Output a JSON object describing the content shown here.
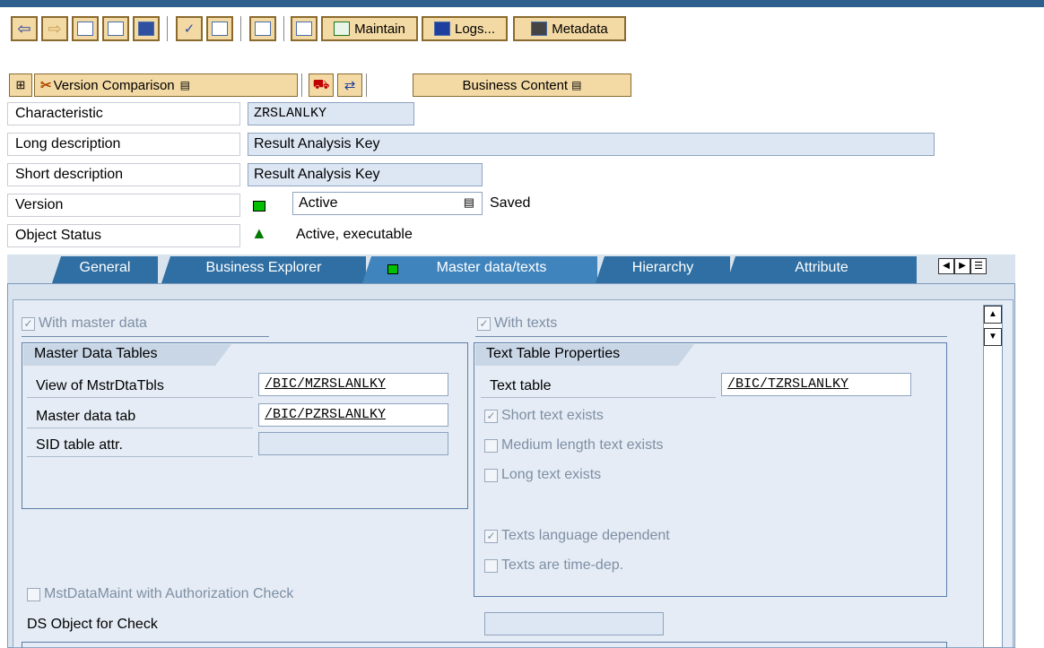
{
  "toolbar": {
    "maintain_label": "Maintain",
    "logs_label": "Logs...",
    "metadata_label": "Metadata"
  },
  "app_toolbar": {
    "version_comparison_label": "Version Comparison",
    "business_content_label": "Business Content"
  },
  "header": {
    "characteristic_label": "Characteristic",
    "characteristic_value": "ZRSLANLKY",
    "long_desc_label": "Long description",
    "long_desc_value": "Result Analysis Key",
    "short_desc_label": "Short description",
    "short_desc_value": "Result Analysis Key",
    "version_label": "Version",
    "version_value": "Active",
    "version_status": "Saved",
    "object_status_label": "Object Status",
    "object_status_value": "Active, executable"
  },
  "tabs": [
    {
      "label": "General"
    },
    {
      "label": "Business Explorer"
    },
    {
      "label": "Master data/texts"
    },
    {
      "label": "Hierarchy"
    },
    {
      "label": "Attribute"
    }
  ],
  "master": {
    "with_master_data_label": "With master data",
    "group_title": "Master Data Tables",
    "view_label": "View of MstrDtaTbls",
    "view_value": "/BIC/MZRSLANLKY",
    "tab_label": "Master data tab",
    "tab_value": "/BIC/PZRSLANLKY",
    "sid_label": "SID table attr.",
    "sid_value": "",
    "auth_check_label": "MstDataMaint with Authorization Check",
    "ds_object_label": "DS Object for Check",
    "ds_object_value": ""
  },
  "texts": {
    "with_texts_label": "With texts",
    "group_title": "Text Table Properties",
    "text_table_label": "Text table",
    "text_table_value": "/BIC/TZRSLANLKY",
    "short_text_label": "Short text exists",
    "medium_text_label": "Medium length text exists",
    "long_text_label": "Long text exists",
    "lang_dep_label": "Texts language dependent",
    "time_dep_label": "Texts are time-dep."
  },
  "colors": {
    "toolbar_button": "#f3d9a4",
    "tab_blue": "#2f6fa3",
    "panel_bg": "#d9e3ee",
    "field_bg": "#dde7f3",
    "status_green": "#00c000"
  }
}
